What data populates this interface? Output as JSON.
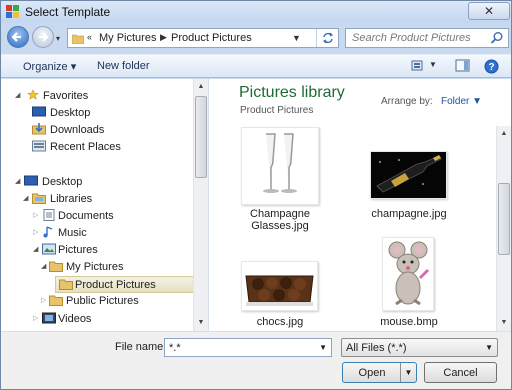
{
  "window": {
    "title": "Select Template",
    "close": "✕"
  },
  "address": {
    "crumbs": [
      "My Pictures",
      "Product Pictures"
    ],
    "overflow": "«"
  },
  "search": {
    "placeholder": "Search Product Pictures"
  },
  "toolbar": {
    "organize": "Organize ▾",
    "new_folder": "New folder"
  },
  "nav": {
    "favorites": "Favorites",
    "desktop_fav": "Desktop",
    "downloads": "Downloads",
    "recent": "Recent Places",
    "desktop": "Desktop",
    "libraries": "Libraries",
    "documents": "Documents",
    "music": "Music",
    "pictures": "Pictures",
    "my_pictures": "My Pictures",
    "product_pictures": "Product Pictures",
    "public_pictures": "Public Pictures",
    "videos": "Videos"
  },
  "library": {
    "title": "Pictures library",
    "subtitle": "Product Pictures",
    "arrange_label": "Arrange by:",
    "arrange_value": "Folder ▼"
  },
  "files": [
    {
      "name": "Champagne Glasses.jpg"
    },
    {
      "name": "champagne.jpg"
    },
    {
      "name": "chocs.jpg"
    },
    {
      "name": "mouse.bmp"
    }
  ],
  "bottom": {
    "file_name_label": "File name:",
    "file_name_value": "*.*",
    "file_type": "All Files (*.*)",
    "open": "Open",
    "cancel": "Cancel"
  },
  "colors": {
    "accent": "#1e6b35",
    "link": "#1a55a8"
  }
}
